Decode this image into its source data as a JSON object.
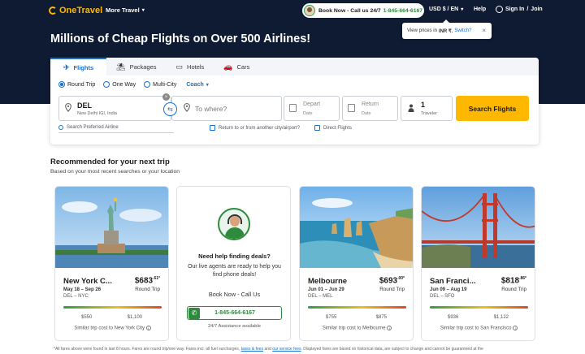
{
  "header": {
    "logo_text": "OneTravel",
    "more_travel": "More Travel",
    "call_label": "Book Now - Call us 24/7",
    "call_number": "1-845-664-6167",
    "currency": "USD $ / EN",
    "help": "Help",
    "sign_in": "Sign In",
    "join": "Join",
    "tooltip_prefix": "View prices in",
    "tooltip_currency": "INR ₹.",
    "tooltip_switch": "Switch?",
    "tooltip_close": "×"
  },
  "headline": "Millions of Cheap Flights on Over 500 Airlines!",
  "tabs": [
    {
      "label": "Flights",
      "icon": "✈"
    },
    {
      "label": "Packages",
      "icon": "⛱"
    },
    {
      "label": "Hotels",
      "icon": "▭"
    },
    {
      "label": "Cars",
      "icon": "🚗"
    }
  ],
  "trip_types": [
    {
      "label": "Round Trip",
      "selected": true
    },
    {
      "label": "One Way",
      "selected": false
    },
    {
      "label": "Multi-City",
      "selected": false
    }
  ],
  "cabin": "Coach",
  "search": {
    "from_code": "DEL",
    "from_name": "New Delhi IGI, India",
    "to_placeholder": "To where?",
    "depart_label": "Depart",
    "depart_sub": "Date",
    "return_label": "Return",
    "return_sub": "Date",
    "travelers_count": "1",
    "travelers_label": "Traveler",
    "button": "Search Flights",
    "preferred_airline": "Search Preferred Airline",
    "return_other": "Return to or from another city/airport?",
    "direct_flights": "Direct Flights"
  },
  "recommended": {
    "title": "Recommended for your next trip",
    "subtitle": "Based on your most recent searches or your location"
  },
  "cards": [
    {
      "city": "New York C...",
      "price": "$683",
      "cents": ".61*",
      "dates": "May 18 – Sep 26",
      "route": "DEL – NYC",
      "trip": "Round Trip",
      "low": "$550",
      "high": "$1,100",
      "foot": "Similar trip cost to New York City"
    },
    {
      "city": "Melbourne",
      "price": "$693",
      "cents": ".00*",
      "dates": "Jun 01 – Jun 29",
      "route": "DEL – MEL",
      "trip": "Round Trip",
      "low": "$755",
      "high": "$875",
      "foot": "Similar trip cost to Melbourne"
    },
    {
      "city": "San Franci...",
      "price": "$818",
      "cents": ".86*",
      "dates": "Jun 09 – Aug 19",
      "route": "DEL – SFO",
      "trip": "Round Trip",
      "low": "$936",
      "high": "$1,122",
      "foot": "Similar trip cost to San Francisco"
    }
  ],
  "help_card": {
    "title": "Need help finding deals?",
    "desc": "Our live agents are ready to help you find phone deals!",
    "book": "Book Now - Call Us",
    "phone": "1-845-664-6167",
    "assist": "24/7 Assistance available"
  },
  "disclaimer": {
    "text1": "*All fares above were found in last 8 hours. Fares are round trip/one way. Fares incl. all fuel surcharges,",
    "link1": "taxes & fees",
    "text2": "and",
    "link2": "our service fees",
    "text3": ". Displayed fares are based on historical data, are subject to change and cannot be guaranteed at the"
  },
  "colors": {
    "hero": "#0f1b33",
    "accent": "#1a6fd1",
    "cta": "#ffb800",
    "phone_green": "#2e8b3d"
  }
}
